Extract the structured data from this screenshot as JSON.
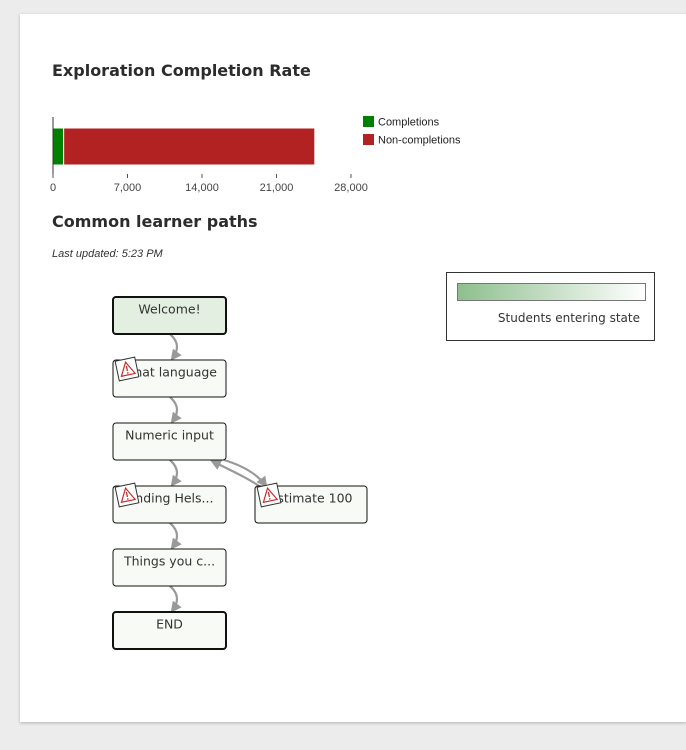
{
  "colors": {
    "completions": "#008000",
    "non_completions": "#b22222",
    "gradient_start": "#8ebf8e",
    "gradient_end": "#ffffff",
    "node_fill": "#f8faf6",
    "node_fill_start": "#e3efe1",
    "edge": "#999999",
    "warning": "#cc2a2a"
  },
  "completion_section": {
    "title": "Exploration Completion Rate"
  },
  "chart_data": {
    "type": "bar",
    "orientation": "horizontal",
    "stacked": true,
    "categories": [
      ""
    ],
    "series": [
      {
        "name": "Completions",
        "values": [
          1000
        ]
      },
      {
        "name": "Non-completions",
        "values": [
          23600
        ]
      }
    ],
    "xlim": [
      0,
      28000
    ],
    "x_ticks": [
      0,
      7000,
      14000,
      21000,
      28000
    ],
    "x_tick_labels": [
      "0",
      "7,000",
      "14,000",
      "21,000",
      "28,000"
    ],
    "legend_position": "right",
    "title": "Exploration Completion Rate"
  },
  "paths_section": {
    "title": "Common learner paths",
    "updated": "Last updated: 5:23 PM",
    "legend_label": "Students entering state",
    "nodes": [
      {
        "id": "welcome",
        "label": "Welcome!",
        "warning": false,
        "emphasis": true,
        "start": true
      },
      {
        "id": "language",
        "label": "What language",
        "warning": true,
        "emphasis": false,
        "start": false
      },
      {
        "id": "numeric",
        "label": "Numeric input",
        "warning": false,
        "emphasis": false,
        "start": false
      },
      {
        "id": "helsinki",
        "label": "Finding Hels...",
        "warning": true,
        "emphasis": false,
        "start": false
      },
      {
        "id": "estimate",
        "label": "Estimate 100",
        "warning": true,
        "emphasis": false,
        "start": false
      },
      {
        "id": "things",
        "label": "Things you c...",
        "warning": false,
        "emphasis": false,
        "start": false
      },
      {
        "id": "end",
        "label": "END",
        "warning": false,
        "emphasis": true,
        "start": false
      }
    ],
    "edges": [
      {
        "from": "welcome",
        "to": "language"
      },
      {
        "from": "language",
        "to": "numeric"
      },
      {
        "from": "numeric",
        "to": "helsinki"
      },
      {
        "from": "numeric",
        "to": "estimate"
      },
      {
        "from": "estimate",
        "to": "numeric"
      },
      {
        "from": "helsinki",
        "to": "things"
      },
      {
        "from": "things",
        "to": "end"
      }
    ]
  }
}
